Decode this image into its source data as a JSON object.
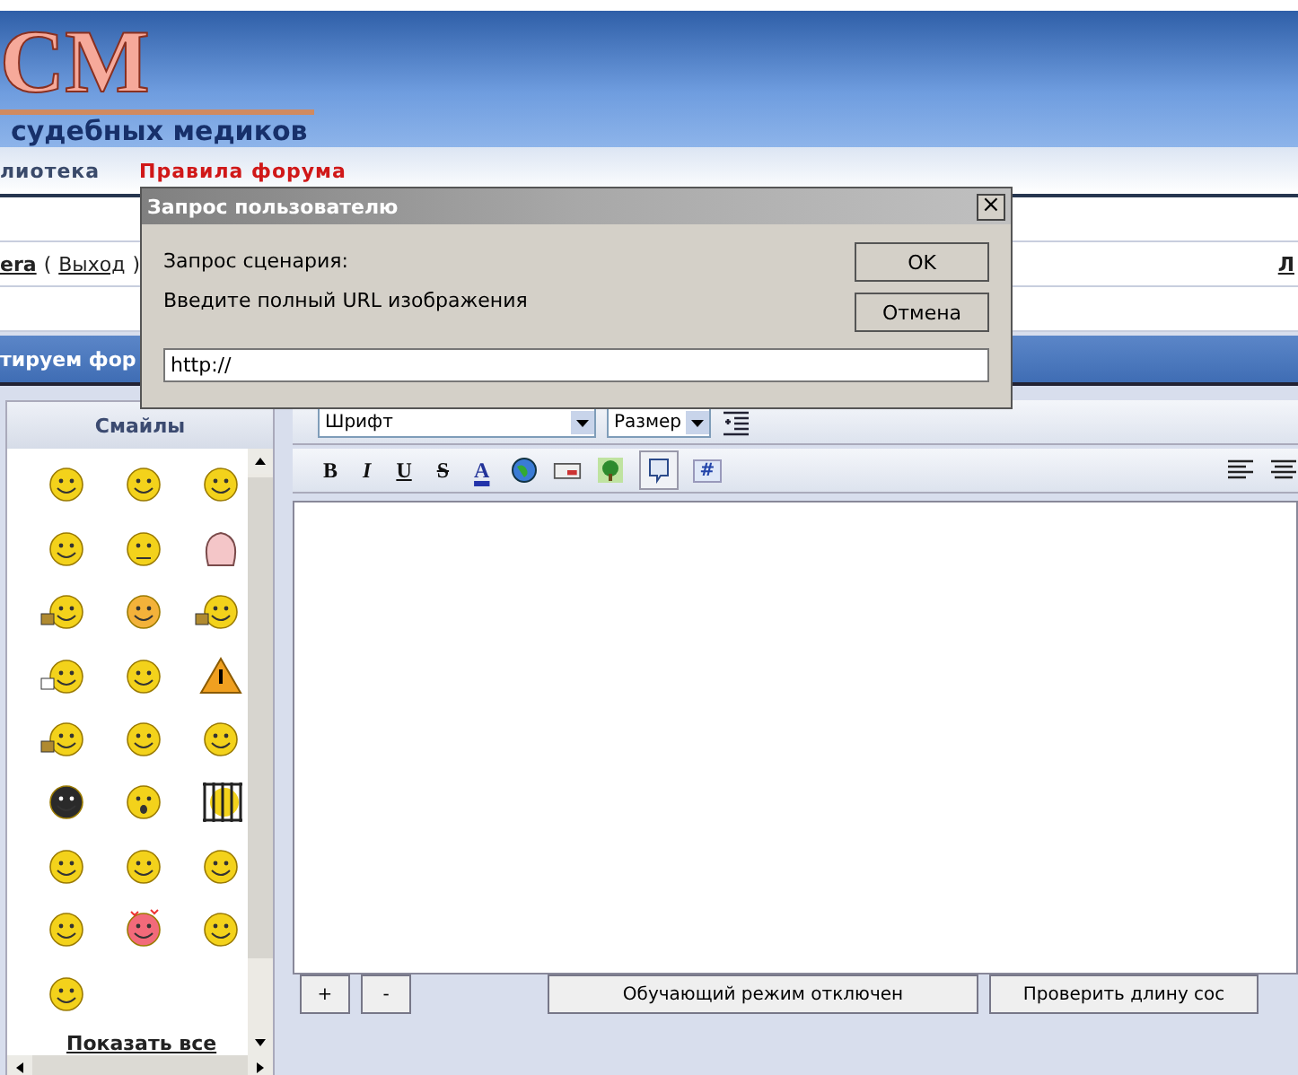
{
  "header": {
    "logo": "СМ",
    "subtitle": "судебных медиков"
  },
  "nav": [
    {
      "label": "лиотека",
      "kind": "plain"
    },
    {
      "label": "Правила форума",
      "kind": "red"
    }
  ],
  "user_row": {
    "user": "era",
    "open": "(",
    "logout": "Выход",
    "close": ")",
    "right_link": "Л"
  },
  "section_title": "тируем фор",
  "smileys": {
    "title": "Смайлы",
    "show_all": "Показать все"
  },
  "editor": {
    "font_select": "Шрифт",
    "size_select": "Размер",
    "format_buttons": [
      "B",
      "I",
      "U",
      "S"
    ],
    "color_button": "A",
    "hash_button": "#",
    "zoom_buttons": [
      "+",
      "-"
    ],
    "tutorial_button": "Обучающий режим отключен",
    "check_button": "Проверить длину сос"
  },
  "dialog": {
    "title": "Запрос пользователю",
    "close": "×",
    "caption": "Запрос сценария:",
    "prompt": "Введите полный URL изображения",
    "ok": "OK",
    "cancel": "Отмена",
    "value": "http://"
  }
}
